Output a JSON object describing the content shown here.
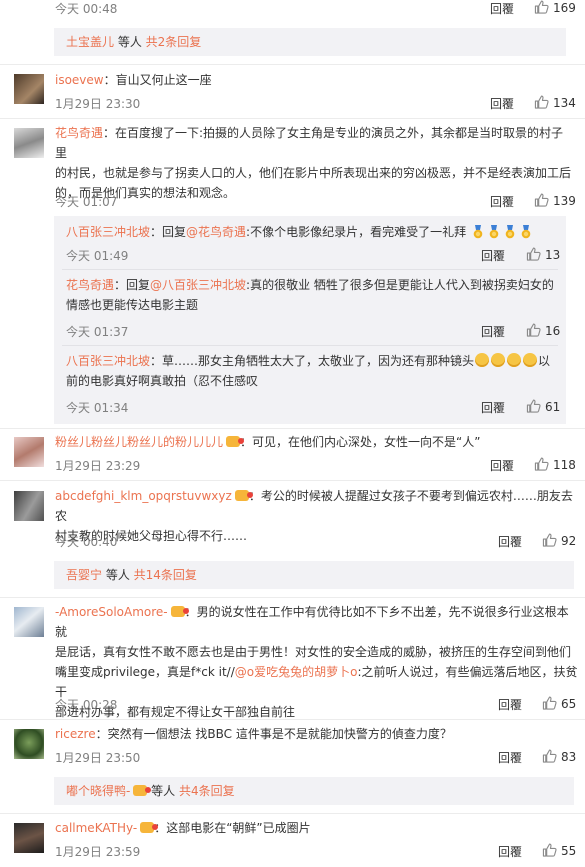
{
  "actions": {
    "reply": "回覆"
  },
  "top": {
    "date": "今天 00:48",
    "likes": "169"
  },
  "summary1": {
    "user": "土宝盖儿",
    "rest": " 等人 ",
    "count": "共2条回复"
  },
  "c1": {
    "user": "isoevew",
    "text": "：盲山又何止这一座",
    "date": "1月29日 23:30",
    "likes": "134"
  },
  "c2": {
    "user": "花鸟奇遇",
    "text_l1": "：在百度搜了一下:拍摄的人员除了女主角是专业的演员之外，其余都是当时取景的村子里",
    "text_l2": "的村民，也就是参与了拐卖人口的人，他们在影片中所表现出来的穷凶极恶，并不是经表演加工后",
    "text_l3": "的，而是他们真实的想法和观念。",
    "date": "今天 01:07",
    "likes": "139"
  },
  "r1": {
    "user": "八百张三冲北坡",
    "reply": "：回复",
    "at": "@花鸟奇遇",
    "text": ":不像个电影像纪录片，看完难受了一礼拜",
    "date": "今天 01:49",
    "likes": "13"
  },
  "r2": {
    "user": "花鸟奇遇",
    "reply": "：回复",
    "at": "@八百张三冲北坡",
    "text_l1": ":真的很敬业 牺牲了很多但是更能让人代入到被拐卖妇女的",
    "text_l2": "情感也更能传达电影主题",
    "date": "今天 01:37",
    "likes": "16"
  },
  "r3": {
    "user": "八百张三冲北坡",
    "text_l1": "：草……那女主角牺牲太大了，太敬业了，因为还有那种镜头",
    "text_l1b": "以",
    "text_l2": "前的电影真好啊真敢拍（忍不住感叹",
    "date": "今天 01:34",
    "likes": "61"
  },
  "c3": {
    "user": "粉丝儿粉丝儿粉丝儿的粉儿儿儿",
    "text": "：可见，在他们内心深处，女性一向不是“人”",
    "date": "1月29日 23:29",
    "likes": "118"
  },
  "c4": {
    "user": "abcdefghi_klm_opqrstuvwxyz",
    "text_l1": "：考公的时候被人提醒过女孩子不要考到偏远农村……朋友去农",
    "text_l2": "村支教的时候她父母担心得不行……",
    "date": "今天 00:40",
    "likes": "92"
  },
  "summary2": {
    "user": "吾婴宁",
    "rest": " 等人 ",
    "count": "共14条回复"
  },
  "c5": {
    "user": "-AmoreSoloAmore-",
    "text_l1": "：男的说女性在工作中有优待比如不下乡不出差，先不说很多行业这根本就",
    "text_l2": "是屁话，真有女性不敢不愿去也是由于男性！对女性的安全造成的威胁，被挤压的生存空间到他们",
    "text_l3a": "嘴里变成privilege，真是f*ck it//",
    "at": "@o爱吃兔兔的胡萝卜o",
    "text_l3b": ":之前听人说过，有些偏远落后地区，扶贫干",
    "text_l4": "部进村办事，都有规定不得让女干部独自前往",
    "date": "今天 00:28",
    "likes": "65"
  },
  "c6": {
    "user": "ricezre",
    "text": "：突然有一個想法 找BBC 這件事是不是就能加快警方的偵查力度？",
    "date": "1月29日 23:50",
    "likes": "83"
  },
  "summary3": {
    "user": "嘟个晓得鸭-",
    "rest": " 等人 ",
    "count": "共4条回复"
  },
  "c7": {
    "user": "callmeKATHy-",
    "text": "：这部电影在“朝鲜”已成圈片",
    "date": "1月29日 23:59",
    "likes": "55"
  }
}
